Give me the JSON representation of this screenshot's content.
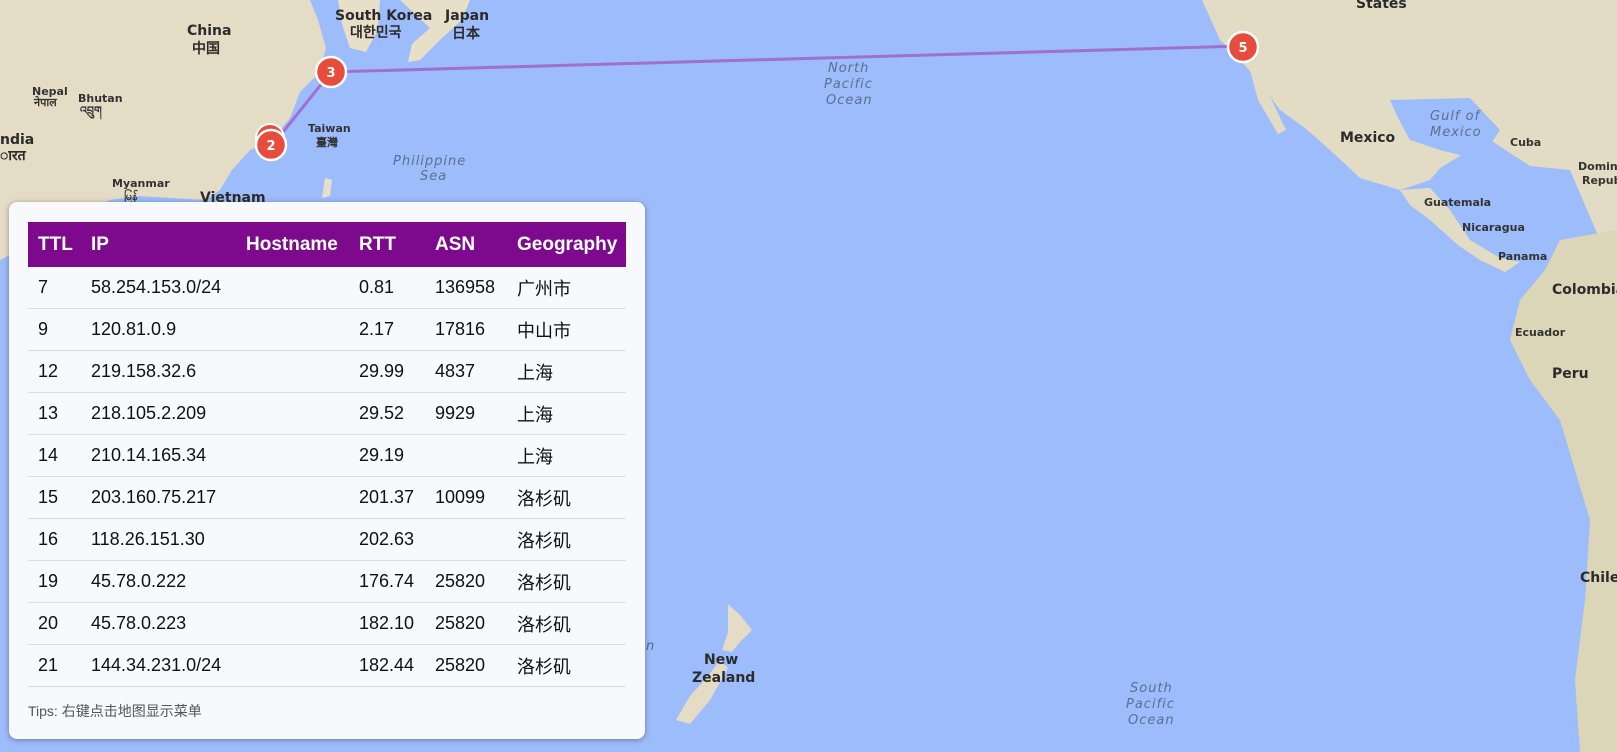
{
  "map": {
    "markers": [
      {
        "label": "2"
      },
      {
        "label": "3"
      },
      {
        "label": "5"
      }
    ],
    "labels": {
      "china_en": "China",
      "china_zh": "中国",
      "south_korea_en": "South Korea",
      "south_korea_ko": "대한민국",
      "japan_en": "Japan",
      "japan_zh": "日本",
      "nepal_en": "Nepal",
      "nepal_local": "नेपाल",
      "bhutan_en": "Bhutan",
      "bhutan_local": "འབྲུག",
      "india_en": "ndia",
      "india_local": "ारत",
      "taiwan_en": "Taiwan",
      "taiwan_zh": "臺灣",
      "myanmar_en": "Myanmar",
      "myanmar_local": "မြန်",
      "vietnam_en": "Vietnam",
      "philippine_sea_1": "Philippine",
      "philippine_sea_2": "Sea",
      "north_pacific_1": "North",
      "north_pacific_2": "Pacific",
      "north_pacific_3": "Ocean",
      "states": "States",
      "mexico": "Mexico",
      "gulf_1": "Gulf of",
      "gulf_2": "Mexico",
      "cuba": "Cuba",
      "dominican_1": "Domini",
      "dominican_2": "Repub",
      "guatemala": "Guatemala",
      "nicaragua": "Nicaragua",
      "panama": "Panama",
      "colombia": "Colombia",
      "ecuador": "Ecuador",
      "peru": "Peru",
      "chile": "Chile",
      "new_zealand_1": "New",
      "new_zealand_2": "Zealand",
      "south_pacific_1": "South",
      "south_pacific_2": "Pacific",
      "south_pacific_3": "Ocean",
      "fragment_n": "n"
    }
  },
  "table": {
    "headers": [
      "TTL",
      "IP",
      "Hostname",
      "RTT",
      "ASN",
      "Geography"
    ],
    "rows": [
      [
        "7",
        "58.254.153.0/24",
        "",
        "0.81",
        "136958",
        "广州市"
      ],
      [
        "9",
        "120.81.0.9",
        "",
        "2.17",
        "17816",
        "中山市"
      ],
      [
        "12",
        "219.158.32.6",
        "",
        "29.99",
        "4837",
        "上海"
      ],
      [
        "13",
        "218.105.2.209",
        "",
        "29.52",
        "9929",
        "上海"
      ],
      [
        "14",
        "210.14.165.34",
        "",
        "29.19",
        "",
        "上海"
      ],
      [
        "15",
        "203.160.75.217",
        "",
        "201.37",
        "10099",
        "洛杉矶"
      ],
      [
        "16",
        "118.26.151.30",
        "",
        "202.63",
        "",
        "洛杉矶"
      ],
      [
        "19",
        "45.78.0.222",
        "",
        "176.74",
        "25820",
        "洛杉矶"
      ],
      [
        "20",
        "45.78.0.223",
        "",
        "182.10",
        "25820",
        "洛杉矶"
      ],
      [
        "21",
        "144.34.231.0/24",
        "",
        "182.44",
        "25820",
        "洛杉矶"
      ]
    ]
  },
  "tips": "Tips: 右键点击地图显示菜单",
  "colors": {
    "ocean": "#9dbcfb",
    "route": "#a06fcf",
    "marker": "#e74c3c",
    "header": "#7d0a8c"
  }
}
